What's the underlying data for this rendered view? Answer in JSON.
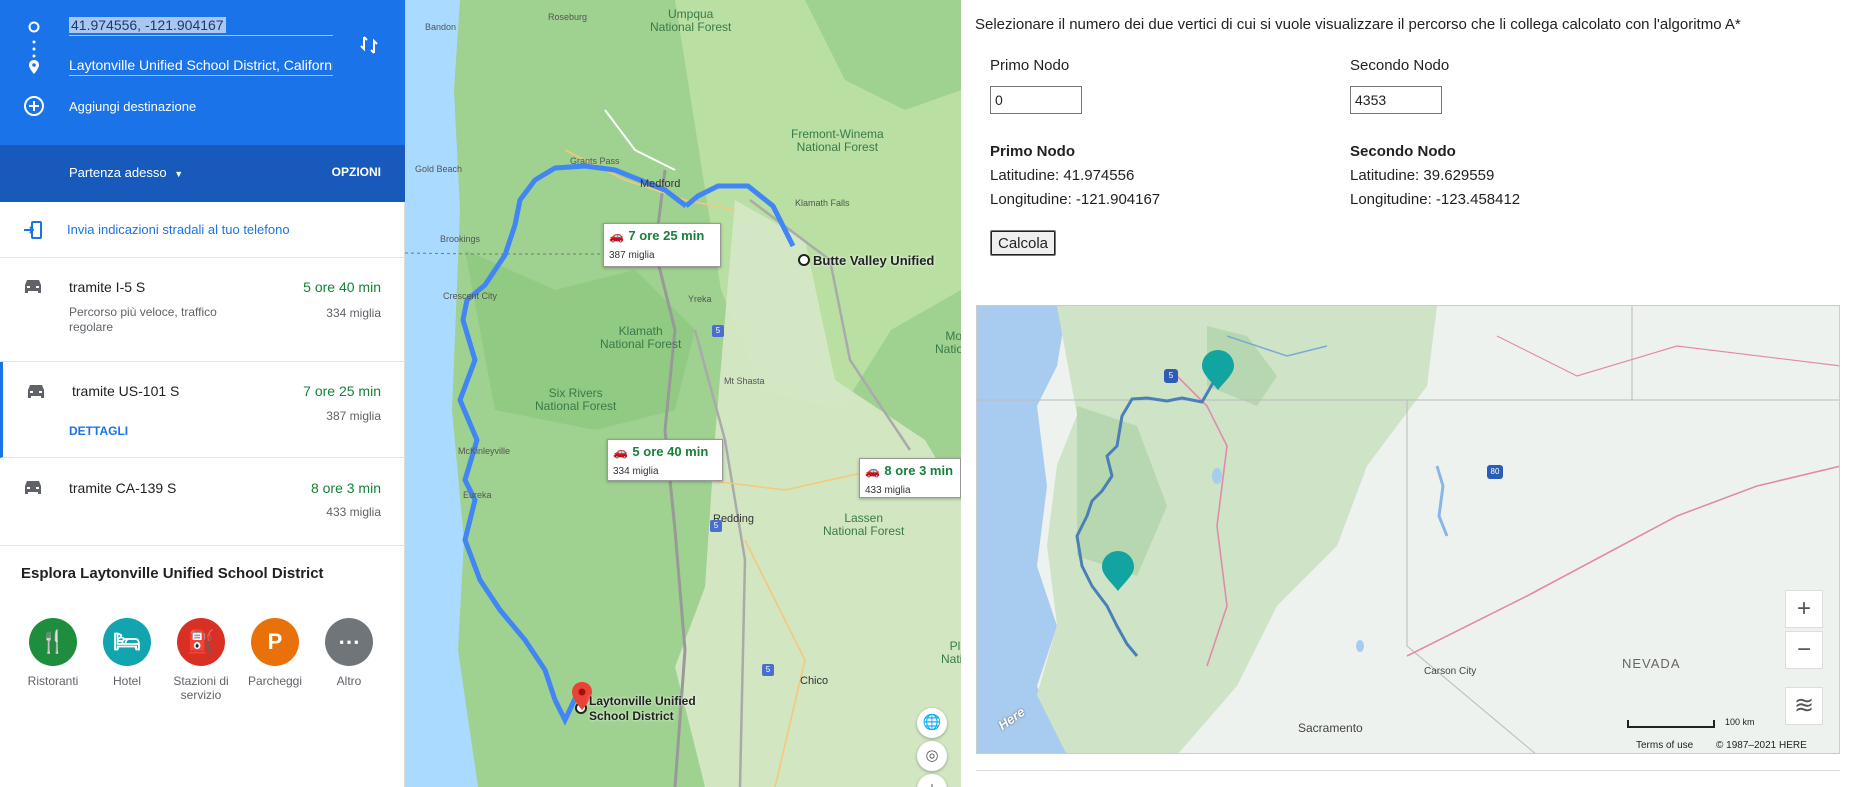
{
  "directions": {
    "origin": "41.974556, -121.904167",
    "destination": "Laytonville Unified School District, California",
    "add_destination": "Aggiungi destinazione",
    "depart": "Partenza adesso",
    "options": "OPZIONI",
    "send_phone": "Invia indicazioni stradali al tuo telefono"
  },
  "routes": [
    {
      "name": "tramite I-5 S",
      "time": "5 ore 40 min",
      "distance": "334 miglia",
      "note": "Percorso più veloce, traffico regolare"
    },
    {
      "name": "tramite US-101 S",
      "time": "7 ore 25 min",
      "distance": "387 miglia",
      "details": "DETTAGLI"
    },
    {
      "name": "tramite CA-139 S",
      "time": "8 ore 3 min",
      "distance": "433 miglia"
    }
  ],
  "explore": {
    "title": "Esplora Laytonville Unified School District",
    "items": [
      {
        "label": "Ristoranti",
        "color": "#1e8e3e",
        "icon": "fork-knife-icon"
      },
      {
        "label": "Hotel",
        "color": "#12a4af",
        "icon": "bed-icon"
      },
      {
        "label": "Stazioni di servizio",
        "color": "#d93025",
        "icon": "gas-icon"
      },
      {
        "label": "Parcheggi",
        "color": "#e8710a",
        "icon": "parking-icon"
      },
      {
        "label": "Altro",
        "color": "#70757a",
        "icon": "more-icon"
      }
    ]
  },
  "gmap": {
    "labels": [
      "Bandon",
      "Roseburg",
      "Umpqua\nNational Forest",
      "Gold Beach",
      "Grants Pass",
      "Medford",
      "Fremont-Winema\nNational Forest",
      "Klamath Falls",
      "Brookings",
      "Crescent City",
      "Butte Valley Unified",
      "Yreka",
      "Klamath\nNational Forest",
      "Mod\nNational",
      "Mt Shasta",
      "Six Rivers\nNational Forest",
      "McKinleyville",
      "Eureka",
      "Redding",
      "Lassen\nNational Forest",
      "Chico",
      "Plu\nNation",
      "Laytonville Unified\nSchool District"
    ],
    "callouts": [
      {
        "time": "7 ore 25 min",
        "dist": "387 miglia"
      },
      {
        "time": "5 ore 40 min",
        "dist": "334 miglia"
      },
      {
        "time": "8 ore 3 min",
        "dist": "433 miglia"
      }
    ],
    "shields": [
      "5",
      "5",
      "5"
    ]
  },
  "page": {
    "instruction": "Selezionare il numero dei due vertici di cui si vuole visualizzare il percorso che li collega calcolato con l'algoritmo A*",
    "first_label": "Primo Nodo",
    "second_label": "Secondo Nodo",
    "first_value": "0",
    "second_value": "4353",
    "first_title": "Primo Nodo",
    "first_lat": "Latitudine: 41.974556",
    "first_lon": "Longitudine: -121.904167",
    "second_title": "Secondo Nodo",
    "second_lat": "Latitudine: 39.629559",
    "second_lon": "Longitudine: -123.458412",
    "button": "Calcola"
  },
  "here_map": {
    "labels": [
      "NEVADA",
      "Carson City",
      "Sacramento"
    ],
    "scale": "100 km",
    "terms": "Terms of use",
    "copyright": "© 1987–2021 HERE",
    "logo": "Here",
    "shields": [
      "5",
      "80"
    ],
    "marker_color": "#12a4a0"
  }
}
